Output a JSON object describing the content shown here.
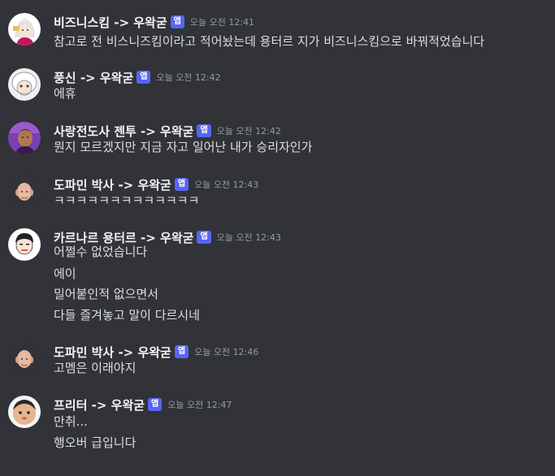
{
  "colors": {
    "background": "#313338",
    "badge": "#5865f2",
    "author": "#f2f3f5",
    "text": "#dbdee1",
    "time": "#949ba4"
  },
  "messages": [
    {
      "author": "비즈니스킴 -> 우왁굳",
      "badge": "앱",
      "time": "오늘 오전 12:41",
      "lines": [
        "참고로 전 비스니즈킴이라고 적어놨는데 용터르 지가 비즈니스킴으로 바꿔적었습니다"
      ],
      "avatar": "pink-haired-character"
    },
    {
      "author": "풍신 -> 우왁굳",
      "badge": "앱",
      "time": "오늘 오전 12:42",
      "lines": [
        "에휴"
      ],
      "avatar": "white-haired-character"
    },
    {
      "author": "사랑전도사 젠투 -> 우왁굳",
      "badge": "앱",
      "time": "오늘 오전 12:42",
      "lines": [
        "뭔지 모르겠지만 지금 자고 일어난 내가 승리자인가"
      ],
      "avatar": "purple-photo-character"
    },
    {
      "author": "도파민 박사 -> 우왁굳",
      "badge": "앱",
      "time": "오늘 오전 12:43",
      "lines": [
        "ㅋㅋㅋㅋㅋㅋㅋㅋㅋㅋㅋㅋㅋ"
      ],
      "avatar": "bald-doctor-character"
    },
    {
      "author": "카르나르 용터르 -> 우왁굳",
      "badge": "앱",
      "time": "오늘 오전 12:43",
      "lines": [
        "어쩔수 없었습니다",
        "에이",
        "밀어붙인적 없으면서",
        "다들 즐겨놓고 말이 다르시네"
      ],
      "avatar": "dark-haired-man-character"
    },
    {
      "author": "도파민 박사 -> 우왁굳",
      "badge": "앱",
      "time": "오늘 오전 12:46",
      "lines": [
        "고멤은 이래야지"
      ],
      "avatar": "bald-doctor-character"
    },
    {
      "author": "프리터 -> 우왁굳",
      "badge": "앱",
      "time": "오늘 오전 12:47",
      "lines": [
        "만취...",
        "행오버 급입니다"
      ],
      "avatar": "round-face-character"
    }
  ]
}
